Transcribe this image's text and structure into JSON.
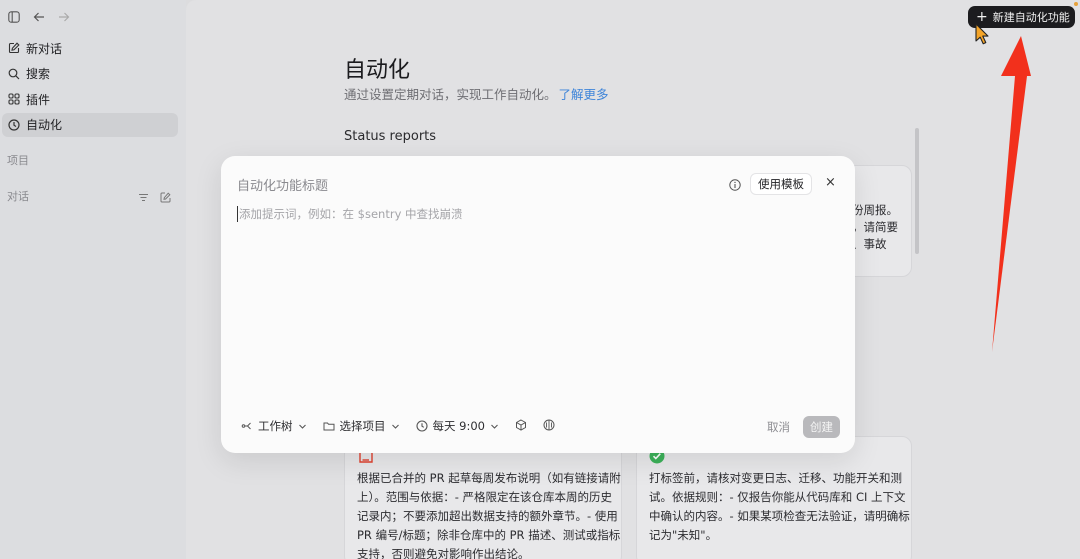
{
  "sidebar": {
    "items": [
      {
        "label": "新对话",
        "icon": "edit-icon"
      },
      {
        "label": "搜索",
        "icon": "search-icon"
      },
      {
        "label": "插件",
        "icon": "plugins-icon"
      },
      {
        "label": "自动化",
        "icon": "clock-icon"
      }
    ],
    "active_item": "自动化",
    "projects_label": "项目",
    "chats_label": "对话"
  },
  "header": {
    "new_automation_button": "新建自动化功能"
  },
  "main": {
    "title": "自动化",
    "subtitle": "通过设置定期对话，实现工作自动化。",
    "learn_more": "了解更多",
    "section_title": "Status reports",
    "card_top_right_fragments": [
      "份周报。",
      "，请简要",
      "、事故"
    ],
    "card_bottom_left_text": [
      "根据已合并的 PR 起草每周发布说明（如有链接请附",
      "上）。范围与依据：- 严格限定在该仓库本周的历史",
      "记录内；不要添加超出数据支持的额外章节。- 使用",
      "PR 编号/标题；除非仓库中的 PR 描述、测试或指标",
      "支持，否则避免对影响作出结论。"
    ],
    "card_bottom_right_text": [
      "打标签前，请核对变更日志、迁移、功能开关和测",
      "试。依据规则：- 仅报告你能从代码库和 CI 上下文",
      "中确认的内容。- 如果某项检查无法验证，请明确标",
      "记为\"未知\"。"
    ]
  },
  "modal": {
    "title_placeholder": "自动化功能标题",
    "template_button": "使用模板",
    "close": "×",
    "prompt_placeholder": "添加提示词，例如：在 $sentry 中查找崩溃",
    "worktree": "工作树",
    "project_select": "选择项目",
    "schedule": "每天 9:00",
    "cancel": "取消",
    "create": "创建"
  },
  "colors": {
    "accent_link": "#3f85d9",
    "arrow_annotation": "#f2301c",
    "dark_button": "#1c1c1f",
    "check_green": "#3cb25a",
    "doc_red": "#e0412f"
  }
}
